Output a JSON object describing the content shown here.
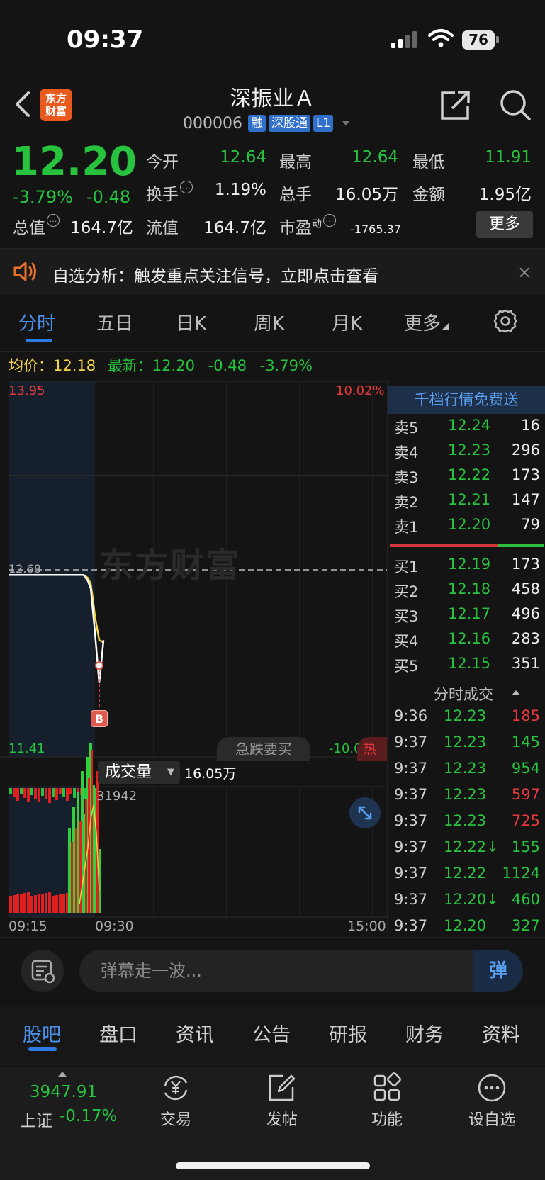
{
  "status": {
    "time": "09:37",
    "battery": "76"
  },
  "header": {
    "logo": "东方财富",
    "logo_line1": "东方",
    "logo_line2": "财富",
    "name": "深振业Ａ",
    "code": "000006",
    "tags": [
      "融",
      "深股通",
      "L1"
    ]
  },
  "quote": {
    "price": "12.20",
    "pct": "-3.79%",
    "change": "-0.48",
    "fields": [
      {
        "label": "今开",
        "value": "12.64",
        "color": "#27c33f"
      },
      {
        "label": "最高",
        "value": "12.64",
        "color": "#27c33f"
      },
      {
        "label": "最低",
        "value": "11.91",
        "color": "#27c33f"
      },
      {
        "label": "换手",
        "value": "1.19%",
        "color": "#f0f0f0"
      },
      {
        "label": "总手",
        "value": "16.05万",
        "color": "#f0f0f0"
      },
      {
        "label": "金额",
        "value": "1.95亿",
        "color": "#f0f0f0"
      },
      {
        "label": "总值",
        "value": "164.7亿",
        "color": "#f0f0f0"
      },
      {
        "label": "流值",
        "value": "164.7亿",
        "color": "#f0f0f0"
      },
      {
        "label": "市盈",
        "sup": "动",
        "value": "-1765.37",
        "color": "#f0f0f0"
      }
    ],
    "more": "更多"
  },
  "banner": {
    "text": "自选分析：触发重点关注信号，立即点击查看",
    "close": "×"
  },
  "tabs": [
    "分时",
    "五日",
    "日K",
    "周K",
    "月K",
    "更多"
  ],
  "avg_row": {
    "avg_label": "均价：",
    "avg_value": "12.18",
    "last_label": "最新：",
    "last_value": "12.20",
    "change": "-0.48",
    "pct": "-3.79%"
  },
  "chart": {
    "hi": "13.95",
    "lo": "11.41",
    "mid": "12.68",
    "pct_hi": "10.02%",
    "pct_lo": "-10.02%",
    "watermark": "东方财富",
    "jump_chip": "急跌要买",
    "hot_chip": "热",
    "vol_selector": "成交量",
    "vol_total": "16.05万",
    "vol_max": "31942",
    "times": [
      "09:15",
      "09:30",
      "15:00"
    ],
    "b_marker": "B"
  },
  "chart_data": {
    "type": "line",
    "title": "分时",
    "ylim": [
      11.41,
      13.95
    ],
    "prev_close": 12.68,
    "x": [
      "09:25",
      "09:30",
      "09:31",
      "09:32",
      "09:33",
      "09:34",
      "09:35",
      "09:36",
      "09:37"
    ],
    "series": [
      {
        "name": "最新",
        "values": [
          12.64,
          12.64,
          12.6,
          12.55,
          12.4,
          12.25,
          11.91,
          12.1,
          12.2
        ]
      },
      {
        "name": "均价",
        "values": [
          12.64,
          12.64,
          12.62,
          12.58,
          12.48,
          12.36,
          12.2,
          12.19,
          12.18
        ]
      }
    ],
    "volume_max": 31942
  },
  "orderbook": {
    "promo": "千档行情免费送",
    "asks": [
      {
        "label": "卖5",
        "price": "12.24",
        "vol": "16"
      },
      {
        "label": "卖4",
        "price": "12.23",
        "vol": "296"
      },
      {
        "label": "卖3",
        "price": "12.22",
        "vol": "173"
      },
      {
        "label": "卖2",
        "price": "12.21",
        "vol": "147"
      },
      {
        "label": "卖1",
        "price": "12.20",
        "vol": "79"
      }
    ],
    "bids": [
      {
        "label": "买1",
        "price": "12.19",
        "vol": "173"
      },
      {
        "label": "买2",
        "price": "12.18",
        "vol": "458"
      },
      {
        "label": "买3",
        "price": "12.17",
        "vol": "496"
      },
      {
        "label": "买4",
        "price": "12.16",
        "vol": "283"
      },
      {
        "label": "买5",
        "price": "12.15",
        "vol": "351"
      }
    ]
  },
  "ticks": {
    "title": "分时成交",
    "rows": [
      {
        "time": "9:36",
        "price": "12.23",
        "vol": "185",
        "color": "#e8383d"
      },
      {
        "time": "9:37",
        "price": "12.23",
        "vol": "145",
        "color": "#27c33f"
      },
      {
        "time": "9:37",
        "price": "12.23",
        "vol": "954",
        "color": "#27c33f"
      },
      {
        "time": "9:37",
        "price": "12.23",
        "vol": "597",
        "color": "#e8383d"
      },
      {
        "time": "9:37",
        "price": "12.23",
        "vol": "725",
        "color": "#e8383d"
      },
      {
        "time": "9:37",
        "price": "12.22↓",
        "vol": "155",
        "color": "#27c33f"
      },
      {
        "time": "9:37",
        "price": "12.22",
        "vol": "1124",
        "color": "#27c33f"
      },
      {
        "time": "9:37",
        "price": "12.20↓",
        "vol": "460",
        "color": "#27c33f"
      },
      {
        "time": "9:37",
        "price": "12.20",
        "vol": "327",
        "color": "#27c33f"
      }
    ]
  },
  "bullet": {
    "placeholder": "弹幕走一波...",
    "send": "弹"
  },
  "content_tabs": [
    "股吧",
    "盘口",
    "资讯",
    "公告",
    "研报",
    "财务",
    "资料"
  ],
  "bottom_nav": {
    "index_value": "3947.91",
    "index_name": "上证",
    "index_pct": "-0.17%",
    "items": [
      "交易",
      "发帖",
      "功能",
      "设自选"
    ]
  }
}
